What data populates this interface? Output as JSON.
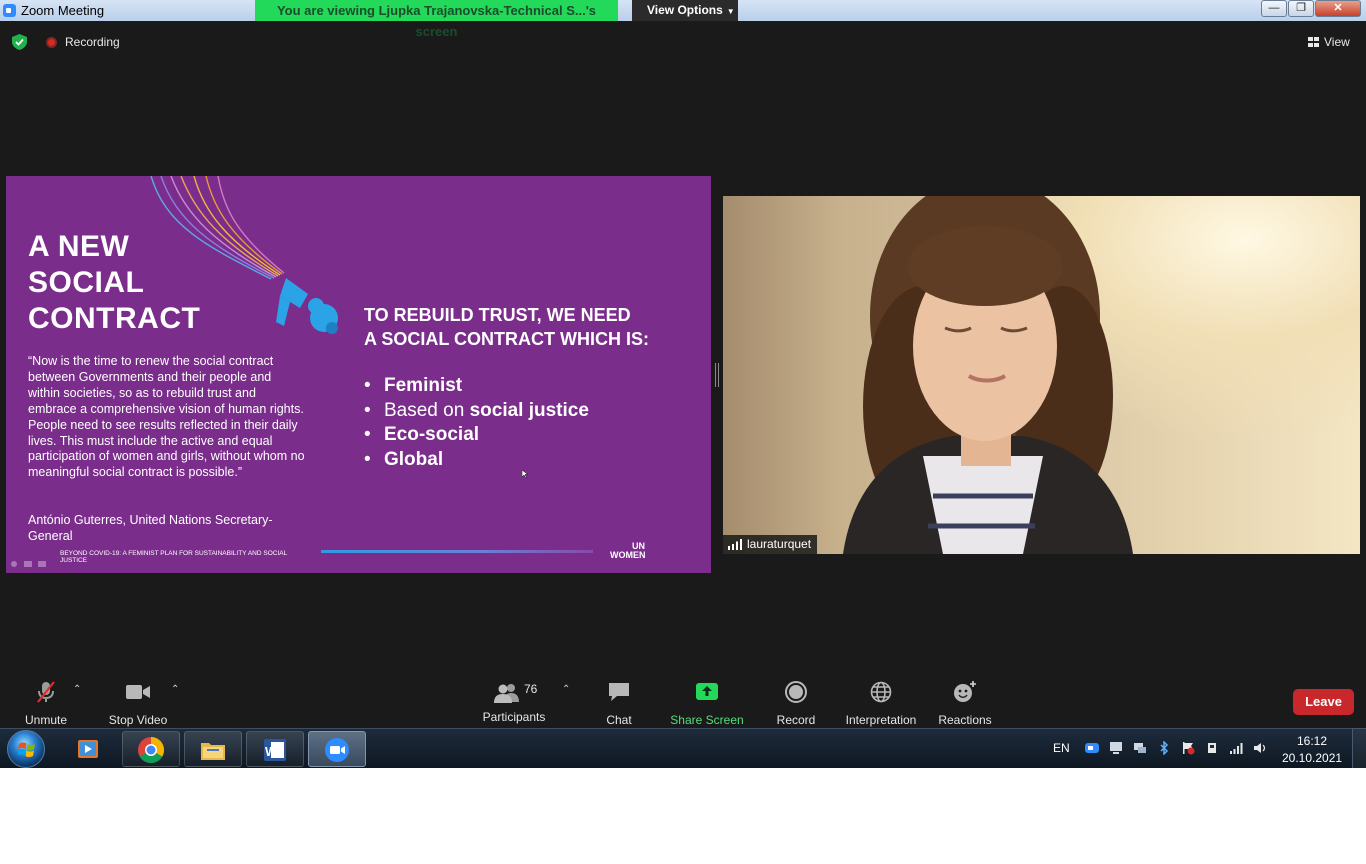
{
  "window": {
    "title": "Zoom Meeting",
    "share_banner": "You are viewing Ljupka Trajanovska-Technical S...'s screen",
    "view_options": "View Options"
  },
  "status": {
    "recording": "Recording",
    "view": "View"
  },
  "slide": {
    "title_lines": [
      "A NEW",
      "SOCIAL",
      "CONTRACT"
    ],
    "quote": "“Now is the time to renew the social contract between Governments and their people and within societies, so as to rebuild trust and embrace a comprehensive vision of human rights. People need to see results reflected in their daily lives. This must include the active and equal participation of women and girls, without whom no meaningful social contract is possible.”",
    "author": "António Guterres, United Nations Secretary-General",
    "heading_lines": [
      "TO REBUILD TRUST, WE NEED",
      "A SOCIAL CONTRACT WHICH IS:"
    ],
    "bullets": [
      {
        "bold": "Feminist",
        "pre": "",
        "post": ""
      },
      {
        "bold": "social justice",
        "pre": "Based on ",
        "post": ""
      },
      {
        "bold": "Eco-social",
        "pre": "",
        "post": ""
      },
      {
        "bold": "Global",
        "pre": "",
        "post": ""
      }
    ],
    "footer": "BEYOND COVID-19: A FEMINIST PLAN FOR SUSTAINABILITY AND SOCIAL JUSTICE",
    "logo_lines": [
      "UN",
      "WOMEN"
    ],
    "bg_color": "#7b2d8b"
  },
  "video": {
    "participant_name": "lauraturquet"
  },
  "toolbar": {
    "unmute": "Unmute",
    "stop_video": "Stop Video",
    "participants": "Participants",
    "participants_count": "76",
    "chat": "Chat",
    "share_screen": "Share Screen",
    "record": "Record",
    "interpretation": "Interpretation",
    "reactions": "Reactions",
    "leave": "Leave",
    "share_color": "#23d959",
    "leave_color": "#c8272b"
  },
  "taskbar": {
    "language": "EN",
    "time": "16:12",
    "date": "20.10.2021"
  }
}
